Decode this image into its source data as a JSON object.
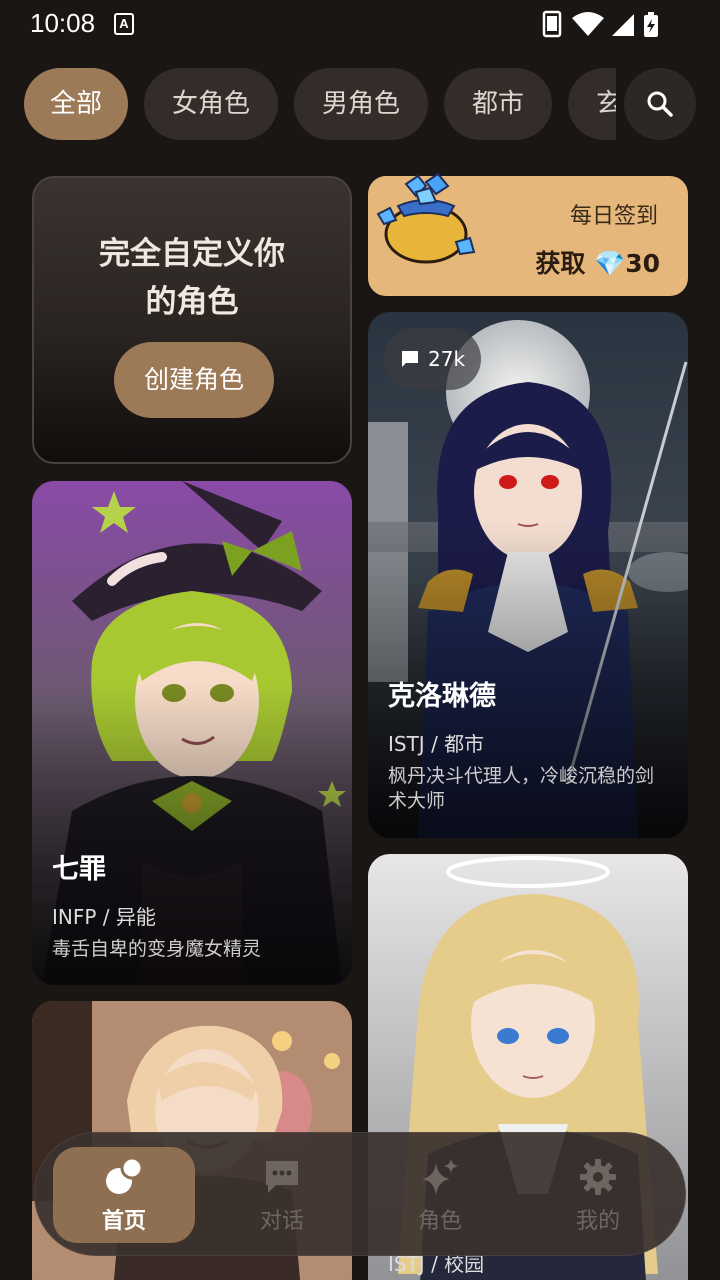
{
  "status_bar": {
    "time": "10:08",
    "notif_badge": "A"
  },
  "filters": {
    "tabs": [
      {
        "label": "全部",
        "active": true
      },
      {
        "label": "女角色",
        "active": false
      },
      {
        "label": "男角色",
        "active": false
      },
      {
        "label": "都市",
        "active": false
      },
      {
        "label": "玄",
        "active": false
      }
    ],
    "search_icon": "search-icon"
  },
  "create_card": {
    "title_line1": "完全自定义你",
    "title_line2": "的角色",
    "button": "创建角色"
  },
  "daily": {
    "title": "每日签到",
    "reward_prefix": "获取 ",
    "reward_icon": "💎",
    "reward_amount": "30"
  },
  "cards": [
    {
      "name": "七罪",
      "meta": "INFP / 异能",
      "desc": "毒舌自卑的变身魔女精灵"
    },
    {
      "name": "克洛琳德",
      "meta": "ISTJ / 都市",
      "desc": "枫丹决斗代理人，冷峻沉稳的剑术大师",
      "chat_count": "27k"
    },
    {
      "name": "",
      "meta": "",
      "desc": ""
    },
    {
      "name": "",
      "meta": "ISTJ / 校园",
      "desc": ""
    }
  ],
  "nav": [
    {
      "label": "首页",
      "icon": "home-bubbles-icon",
      "active": true
    },
    {
      "label": "对话",
      "icon": "chat-icon",
      "active": false
    },
    {
      "label": "角色",
      "icon": "sparkle-icon",
      "active": false
    },
    {
      "label": "我的",
      "icon": "gear-icon",
      "active": false
    }
  ],
  "colors": {
    "background": "#1a1614",
    "accent": "#9c7a58",
    "chip": "#332c29",
    "daily": "#e6b77a"
  }
}
